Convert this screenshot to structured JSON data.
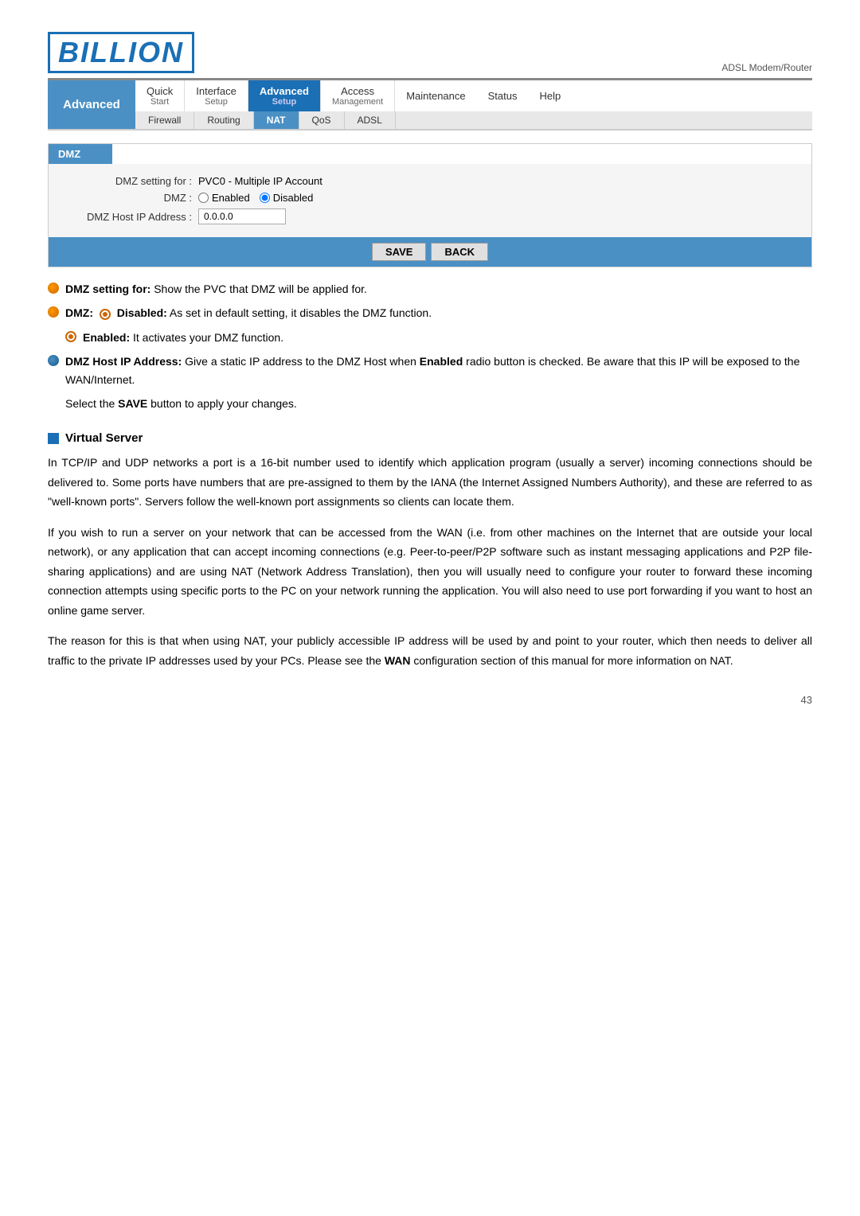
{
  "logo": {
    "text": "BILLION",
    "adsl_label": "ADSL Modem/Router"
  },
  "nav": {
    "sidebar_label": "Advanced",
    "top_items": [
      {
        "id": "quick-start",
        "label": "Quick",
        "sublabel": "Start"
      },
      {
        "id": "interface-setup",
        "label": "Interface",
        "sublabel": "Setup"
      },
      {
        "id": "advanced-setup",
        "label": "Advanced",
        "sublabel": "Setup",
        "active": true
      },
      {
        "id": "access-management",
        "label": "Access",
        "sublabel": "Management"
      },
      {
        "id": "maintenance",
        "label": "Maintenance",
        "sublabel": ""
      },
      {
        "id": "status",
        "label": "Status",
        "sublabel": ""
      },
      {
        "id": "help",
        "label": "Help",
        "sublabel": ""
      }
    ],
    "sub_items": [
      {
        "id": "firewall",
        "label": "Firewall"
      },
      {
        "id": "routing",
        "label": "Routing"
      },
      {
        "id": "nat",
        "label": "NAT",
        "active": true
      },
      {
        "id": "qos",
        "label": "QoS"
      },
      {
        "id": "adsl",
        "label": "ADSL"
      }
    ]
  },
  "dmz": {
    "header": "DMZ",
    "setting_label": "DMZ setting for :",
    "setting_value": "PVC0 - Multiple IP Account",
    "dmz_label": "DMZ :",
    "radio_enabled": "Enabled",
    "radio_disabled": "Disabled",
    "host_ip_label": "DMZ Host IP Address :",
    "host_ip_value": "0.0.0.0",
    "save_btn": "SAVE",
    "back_btn": "BACK"
  },
  "help": {
    "dmz_setting_for_bullet": "orange",
    "dmz_setting_for_label": "DMZ setting for:",
    "dmz_setting_for_text": " Show the PVC that DMZ will be applied for.",
    "dmz_disabled_label": "DMZ:",
    "dmz_disabled_icon": "target",
    "dmz_disabled_text": " Disabled:",
    "dmz_disabled_desc": " As set in default setting, it disables the DMZ function.",
    "dmz_enabled_label": "Enabled:",
    "dmz_enabled_desc": " It activates your DMZ function.",
    "dmz_host_ip_label": "DMZ Host IP Address:",
    "dmz_host_ip_text": "  Give a static IP address to the DMZ Host when ",
    "dmz_host_ip_bold": "Enabled",
    "dmz_host_ip_text2": " radio button is checked. Be aware that this IP will be exposed to the WAN/Internet.",
    "dmz_host_ip_text3": "Select the ",
    "dmz_save_bold": "SAVE",
    "dmz_host_ip_text4": " button to apply your changes."
  },
  "virtual_server": {
    "title": "Virtual Server",
    "para1": "In TCP/IP and UDP networks a port is a 16-bit number used to identify which application program (usually a server) incoming connections should be delivered to. Some ports have numbers that are pre-assigned to them by the IANA (the Internet Assigned Numbers Authority), and these are referred to as \"well-known ports\". Servers follow the well-known port assignments so clients can locate them.",
    "para2": "If you wish to run a server on your network that can be accessed from the WAN (i.e. from other machines on the Internet that are outside your local network), or any application that can accept incoming connections (e.g. Peer-to-peer/P2P software such as instant messaging applications and P2P file-sharing applications) and are using NAT (Network Address Translation), then you will usually need to configure your router to forward these incoming connection attempts using specific ports to the PC on your network running the application. You will also need to use port forwarding if you want to host an online game server.",
    "para3": "The reason for this is that when using NAT, your publicly accessible IP address will be used by and point to your router, which then needs to deliver all traffic to the private IP addresses used by your PCs. Please see the WAN configuration section of this manual for more information on NAT.",
    "wan_bold": "WAN"
  },
  "page_number": "43"
}
